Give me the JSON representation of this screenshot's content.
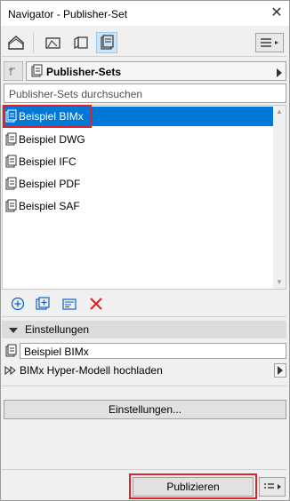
{
  "window": {
    "title": "Navigator - Publisher-Set",
    "close_glyph": "✕"
  },
  "toolbar": {
    "buttons": [
      {
        "icon": "project-map-icon"
      },
      {
        "icon": "view-map-icon"
      },
      {
        "icon": "layout-book-icon"
      },
      {
        "icon": "publisher-sets-icon",
        "active": true
      }
    ],
    "menu_icon": "hamburger-menu-icon"
  },
  "selector": {
    "up_icon": "up-arrow-icon",
    "label": "Publisher-Sets"
  },
  "search": {
    "placeholder": "Publisher-Sets durchsuchen",
    "value": ""
  },
  "list": {
    "items": [
      {
        "label": "Beispiel BIMx",
        "selected": true
      },
      {
        "label": "Beispiel DWG",
        "selected": false
      },
      {
        "label": "Beispiel IFC",
        "selected": false
      },
      {
        "label": "Beispiel PDF",
        "selected": false
      },
      {
        "label": "Beispiel SAF",
        "selected": false
      }
    ]
  },
  "actions": [
    {
      "icon": "add-folder-icon"
    },
    {
      "icon": "new-publisher-set-icon"
    },
    {
      "icon": "set-properties-icon"
    },
    {
      "icon": "delete-icon"
    }
  ],
  "settings": {
    "header": "Einstellungen",
    "set_name": "Beispiel BIMx",
    "format_label": "BIMx Hyper-Modell hochladen",
    "settings_button": "Einstellungen..."
  },
  "footer": {
    "publish_button": "Publizieren",
    "menu_icon": "publish-options-icon"
  },
  "colors": {
    "selection": "#0078d7",
    "highlight_box": "#e0222a",
    "delete": "#e0222a",
    "accent_icon": "#0a64c8"
  }
}
